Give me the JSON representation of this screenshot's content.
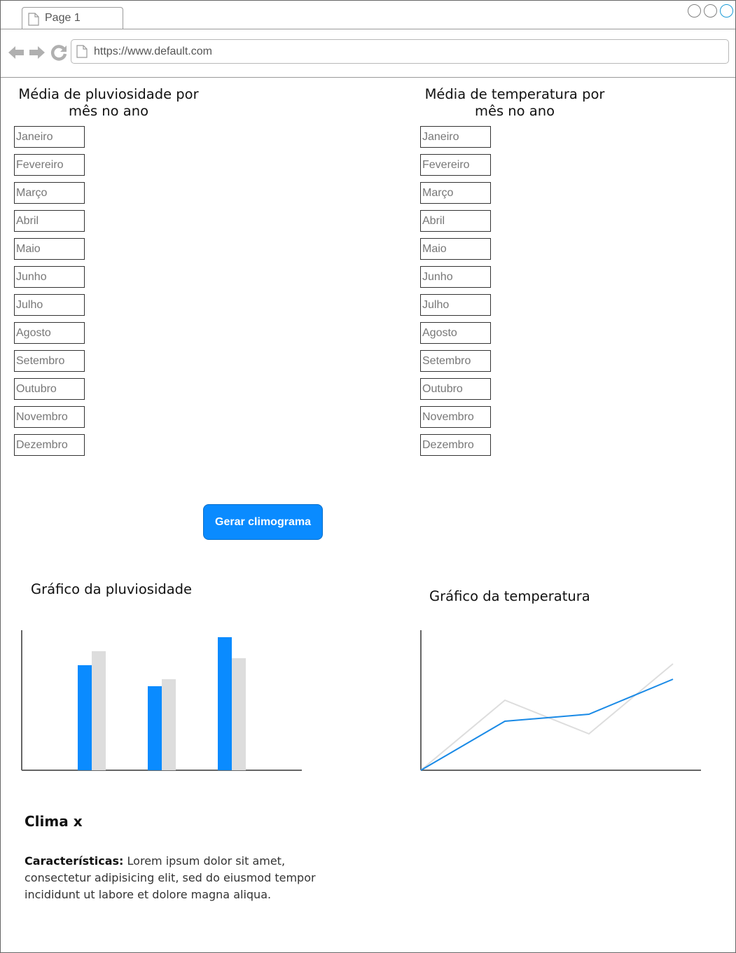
{
  "browser": {
    "tab_label": "Page 1",
    "url": "https://www.default.com",
    "icons": [
      "page-icon",
      "back-arrow-icon",
      "forward-arrow-icon",
      "reload-icon"
    ]
  },
  "rain_section": {
    "title_line1": "Média de pluviosidade por",
    "title_line2": "mês no ano",
    "months": [
      "Janeiro",
      "Fevereiro",
      "Março",
      "Abril",
      "Maio",
      "Junho",
      "Julho",
      "Agosto",
      "Setembro",
      "Outubro",
      "Novembro",
      "Dezembro"
    ]
  },
  "temp_section": {
    "title_line1": "Média de temperatura por",
    "title_line2": "mês no ano",
    "months": [
      "Janeiro",
      "Fevereiro",
      "Março",
      "Abril",
      "Maio",
      "Junho",
      "Julho",
      "Agosto",
      "Setembro",
      "Outubro",
      "Novembro",
      "Dezembro"
    ]
  },
  "generate_button": {
    "label": "Gerar climograma",
    "color": "#0a8bff"
  },
  "charts": {
    "rain_title": "Gráfico da pluviosidade",
    "temp_title": "Gráfico da temperatura"
  },
  "chart_data": [
    {
      "type": "bar",
      "categories": [
        "",
        "",
        ""
      ],
      "series": [
        {
          "values": [
            150,
            120,
            190
          ],
          "color": "#0a8bff"
        },
        {
          "values": [
            170,
            130,
            160
          ],
          "color": "#dddddd"
        }
      ],
      "ylim": [
        0,
        200
      ],
      "grid": false
    },
    {
      "type": "line",
      "x": [
        0,
        1,
        2,
        3
      ],
      "series": [
        {
          "values": [
            0,
            70,
            80,
            130
          ],
          "color": "#1a8ae6"
        },
        {
          "values": [
            0,
            100,
            52,
            152
          ],
          "color": "#dddddd"
        }
      ],
      "ylim": [
        0,
        200
      ],
      "grid": false
    }
  ],
  "climate": {
    "title": "Clima x",
    "label": "Características:",
    "text": " Lorem ipsum dolor sit amet, consectetur adipisicing elit, sed do eiusmod tempor incididunt ut labore et dolore magna aliqua."
  }
}
